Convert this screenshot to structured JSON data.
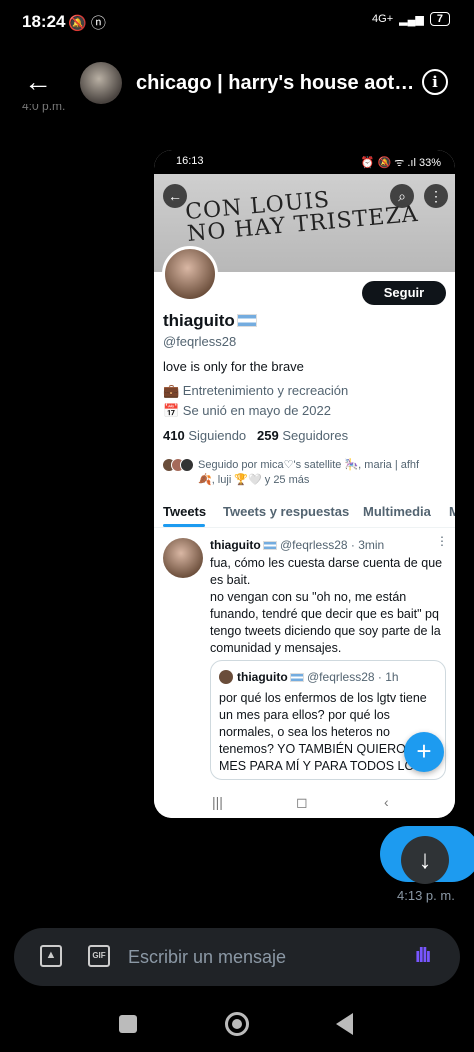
{
  "status_bar": {
    "time": "18:24",
    "icons": "🔕 ⓝ",
    "network": "4G+",
    "battery": "7"
  },
  "header": {
    "back_glyph": "←",
    "title": "chicago | harry's house aoty...",
    "info_glyph": "i"
  },
  "cut_timestamp": "4:0 p.m.",
  "screenshot": {
    "status_time": "16:13",
    "status_right": "⏰ 🔕 ᯤ .ıl 33%",
    "banner_text_line1": "CON LOUIS",
    "banner_text_line2": "NO HAY TRISTEZA",
    "follow_label": "Seguir",
    "name": "thiaguito",
    "handle": "@feqrless28",
    "bio": "love is only for the brave",
    "category": "💼 Entretenimiento y recreación",
    "joined": "📅 Se unió en mayo de 2022",
    "following_count": "410",
    "following_label": "Siguiendo",
    "followers_count": "259",
    "followers_label": "Seguidores",
    "followed_by": "Seguido por mica♡'s satellite 🎠, maria | afhf 🍂, luji 🏆🤍 y 25 más",
    "tabs": [
      "Tweets",
      "Tweets y respuestas",
      "Multimedia",
      "M"
    ],
    "tweet": {
      "name": "thiaguito",
      "handle_time": "@feqrless28 · 3min",
      "text": "fua, cómo les cuesta darse cuenta de que es bait.\nno vengan con su \"oh no, me están funando, tendré que decir que es bait\" pq tengo tweets diciendo que soy parte de la comunidad y mensajes."
    },
    "quote": {
      "name": "thiaguito",
      "handle_time": "@feqrless28 · 1h",
      "text": "por qué los enfermos de los lgtv tiene un mes para ellos? por qué los normales, o sea los heteros no tenemos? YO TAMBIÉN QUIERO UN MES PARA MÍ Y PARA TODOS LOS"
    },
    "fab_glyph": "+",
    "nav": [
      "|||",
      "◻",
      "‹"
    ]
  },
  "message_time": "4:13 p. m.",
  "scroll_glyph": "↓",
  "composer": {
    "placeholder": "Escribir un mensaje",
    "gif_label": "GIF"
  },
  "colors": {
    "accent": "#1d9bf0",
    "voice": "#7856ff",
    "background": "#000000"
  }
}
